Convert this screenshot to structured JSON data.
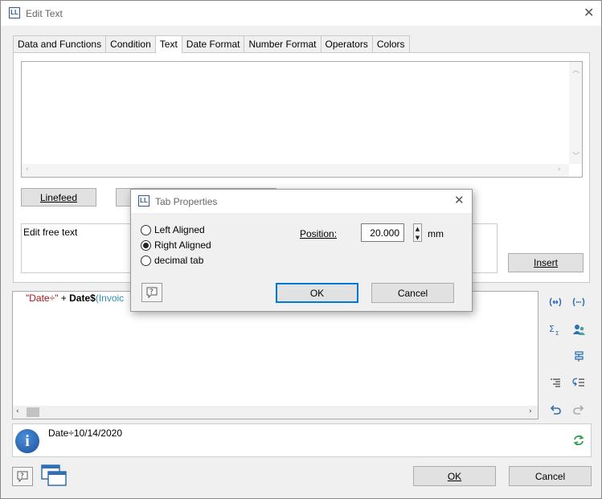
{
  "window": {
    "title": "Edit Text",
    "logo": "LL"
  },
  "tabs": [
    "Data and Functions",
    "Condition",
    "Text",
    "Date Format",
    "Number Format",
    "Operators",
    "Colors"
  ],
  "text_panel": {
    "linefeed_button": "Linefeed",
    "free_text_label": "Edit free text",
    "insert_button": "Insert"
  },
  "editor": {
    "code_string": "\"Date÷\"",
    "code_op": " + ",
    "code_func": "Date$",
    "code_arg": "(Invoic"
  },
  "info": {
    "text": "Date÷10/14/2020"
  },
  "footer": {
    "ok_button": "OK",
    "cancel_button": "Cancel"
  },
  "dialog": {
    "title": "Tab Properties",
    "logo": "LL",
    "options": [
      {
        "label": "Left Aligned",
        "selected": false
      },
      {
        "label": "Right Aligned",
        "selected": true
      },
      {
        "label": "decimal tab",
        "selected": false
      }
    ],
    "position_label": "Position:",
    "position_value": "20.000",
    "unit": "mm",
    "ok_button": "OK",
    "cancel_button": "Cancel"
  },
  "colors": {
    "accent": "#0078d7",
    "string": "#a31515",
    "arg": "#2b91af",
    "icon_blue": "#2f6fb5"
  },
  "icons": [
    "help-icon",
    "window-icon",
    "info-icon",
    "refresh-icon",
    "undo-icon",
    "redo-icon",
    "sum-icon",
    "users-icon",
    "field-icon",
    "format-icon",
    "wrap-icon",
    "table-icon"
  ]
}
